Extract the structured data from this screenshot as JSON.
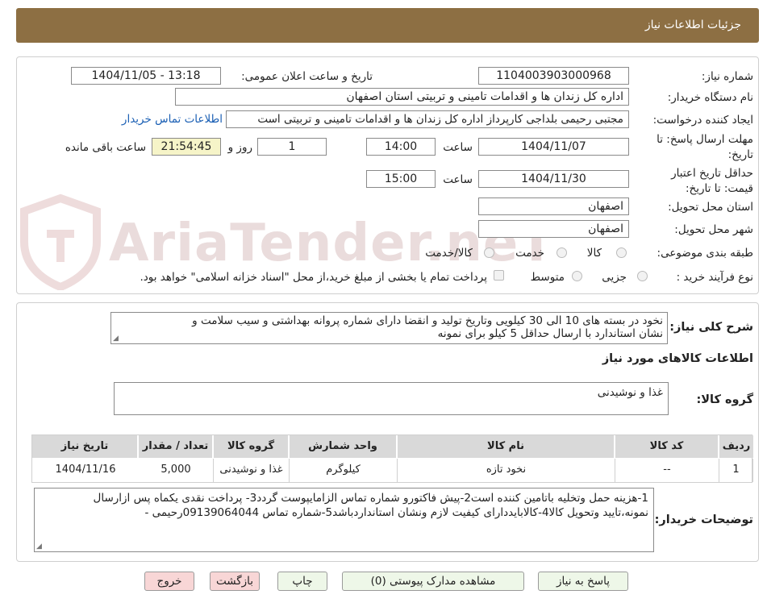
{
  "header": {
    "title": "جزئیات اطلاعات نیاز"
  },
  "watermark": "AriaTender.neT",
  "form": {
    "need_number_label": "شماره نیاز:",
    "need_number": "1104003903000968",
    "announce_label": "تاریخ و ساعت اعلان عمومی:",
    "announce_value": "1404/11/05 - 13:18",
    "buyer_org_label": "نام دستگاه خریدار:",
    "buyer_org": "اداره کل زندان ها و اقدامات تامینی و تربیتی استان اصفهان",
    "requester_label": "ایجاد کننده درخواست:",
    "requester": "مجتبی رحیمی بلداجی کارپرداز اداره کل زندان ها و اقدامات تامینی و تربیتی است",
    "contact_link": "اطلاعات تماس خریدار",
    "deadline_label": "مهلت ارسال پاسخ: تا",
    "deadline_label2": "تاریخ:",
    "deadline_date": "1404/11/07",
    "time_label": "ساعت",
    "deadline_time": "14:00",
    "days_value": "1",
    "days_label": "روز و",
    "remaining_time": "21:54:45",
    "remaining_label": "ساعت باقی مانده",
    "validity_label": "حداقل تاریخ اعتبار",
    "validity_label2": "قیمت: تا تاریخ:",
    "validity_date": "1404/11/30",
    "validity_time": "15:00",
    "province_label": "استان محل تحویل:",
    "province": "اصفهان",
    "city_label": "شهر محل تحویل:",
    "city": "اصفهان",
    "category_label": "طبقه بندی موضوعی:",
    "category_options": [
      "کالا",
      "خدمت",
      "کالا/خدمت"
    ],
    "process_label": "نوع فرآیند خرید :",
    "process_options": [
      "جزیی",
      "متوسط"
    ],
    "process_note": "پرداخت تمام یا بخشی از مبلغ خرید،از محل \"اسناد خزانه اسلامی\" خواهد بود."
  },
  "description": {
    "label": "شرح کلی نیاز:",
    "line1": "نخود  در بسته های 10 الی 30 کیلویی وتاریخ تولید و انقضا  دارای شماره پروانه بهداشتی و سیب سلامت و",
    "line2": "نشان استاندارد  با ارسال حداقل 5 کیلو برای نمونه"
  },
  "goods": {
    "section_title": "اطلاعات کالاهای مورد نیاز",
    "group_label": "گروه کالا:",
    "group_value": "غذا و نوشیدنی",
    "table": {
      "headers": [
        "ردیف",
        "کد کالا",
        "نام کالا",
        "واحد شمارش",
        "گروه کالا",
        "تعداد / مقدار",
        "تاریخ نیاز"
      ],
      "rows": [
        [
          "1",
          "--",
          "نخود تازه",
          "کیلوگرم",
          "غذا و نوشیدنی",
          "5,000",
          "1404/11/16"
        ]
      ]
    }
  },
  "buyer_notes": {
    "label": "توضیحات خریدار:",
    "line1": "1-هزینه حمل وتخلیه باتامین کننده است2-پیش فاکتورو شماره تماس الزامایپوست گردد3- پرداخت نقدی یکماه  پس ازارسال",
    "line2": "نمونه،تایید وتحویل کالا4-کالابایددارای کیفیت لازم ونشان استانداردباشد5-شماره تماس 09139064044رحیمی -"
  },
  "buttons": {
    "reply": "پاسخ به نیاز",
    "attachments": "مشاهده مدارک پیوستی (0)",
    "print": "چاپ",
    "back": "بازگشت",
    "exit": "خروج"
  }
}
